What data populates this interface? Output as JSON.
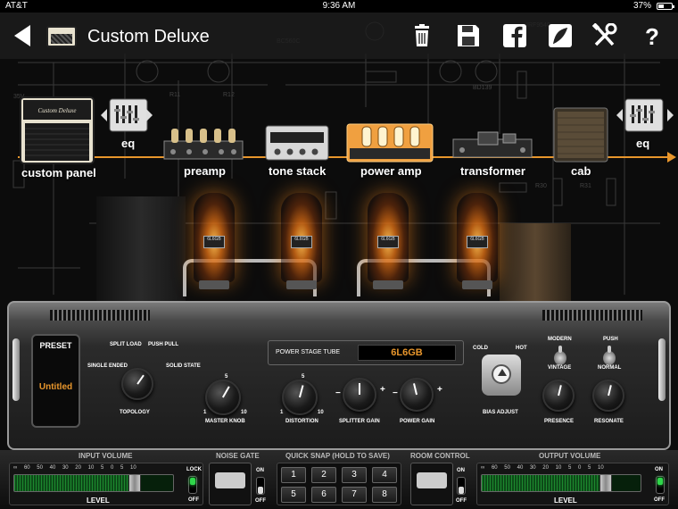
{
  "status_bar": {
    "carrier": "AT&T",
    "time": "9:36 AM",
    "battery": "37%"
  },
  "toolbar": {
    "preset_name": "Custom Deluxe",
    "icons": [
      "back-arrow-icon",
      "amp-thumbnail-icon",
      "trash-icon",
      "save-icon",
      "facebook-icon",
      "share-icon",
      "tools-icon",
      "help-icon"
    ]
  },
  "signal_chain": [
    {
      "label": "custom panel"
    },
    {
      "label": "eq"
    },
    {
      "label": "preamp"
    },
    {
      "label": "tone stack"
    },
    {
      "label": "power amp",
      "selected": true
    },
    {
      "label": "transformer"
    },
    {
      "label": "cab"
    },
    {
      "label": "eq"
    }
  ],
  "tubes": {
    "badge": "6L6GB"
  },
  "faceplate": {
    "preset": {
      "title": "PRESET",
      "value": "Untitled"
    },
    "topology": {
      "label": "TOPOLOGY",
      "options": [
        "SINGLE ENDED",
        "SPLIT LOAD",
        "PUSH PULL",
        "SOLID STATE"
      ],
      "selected": "PUSH PULL"
    },
    "master_knob": {
      "label": "MASTER KNOB",
      "scale_min": "1",
      "scale_mid": "5",
      "scale_max": "10",
      "value": 6.5
    },
    "power_stage_tube": {
      "label": "POWER STAGE TUBE",
      "value": "6L6GB"
    },
    "distortion": {
      "label": "DISTORTION",
      "scale_min": "1",
      "scale_mid": "5",
      "scale_max": "10",
      "value": 6
    },
    "splitter_gain": {
      "label": "SPLITTER GAIN",
      "minus": "−",
      "plus": "+",
      "value": 0.5
    },
    "power_gain": {
      "label": "POWER GAIN",
      "minus": "−",
      "plus": "+",
      "value": 0.45
    },
    "bias": {
      "label": "BIAS ADJUST",
      "cold": "COLD",
      "hot": "HOT"
    },
    "modern_vintage": {
      "top": "MODERN",
      "bottom": "VINTAGE"
    },
    "push_normal": {
      "top": "PUSH",
      "bottom": "NORMAL"
    },
    "presence": {
      "label": "PRESENCE",
      "value": 0.55
    },
    "resonate": {
      "label": "RESONATE",
      "value": 0.55
    }
  },
  "bottom": {
    "input_volume": {
      "title": "INPUT VOLUME",
      "scale": "∞ 60 50 40 30 20 10 5 0 5 10",
      "level_label": "LEVEL",
      "lock_label": "LOCK",
      "off_label": "OFF",
      "level": 0.76
    },
    "noise_gate": {
      "title": "NOISE GATE",
      "on_label": "ON",
      "off_label": "OFF"
    },
    "quick_snap": {
      "title": "QUICK SNAP (HOLD TO SAVE)",
      "buttons": [
        "1",
        "2",
        "3",
        "4",
        "5",
        "6",
        "7",
        "8"
      ]
    },
    "room_control": {
      "title": "ROOM CONTROL",
      "on_label": "ON",
      "off_label": "OFF"
    },
    "output_volume": {
      "title": "OUTPUT VOLUME",
      "scale": "∞ 60 50 40 30 20 10 5 0 5 10",
      "level_label": "LEVEL",
      "on_label": "ON",
      "off_label": "OFF",
      "level": 0.78
    }
  }
}
